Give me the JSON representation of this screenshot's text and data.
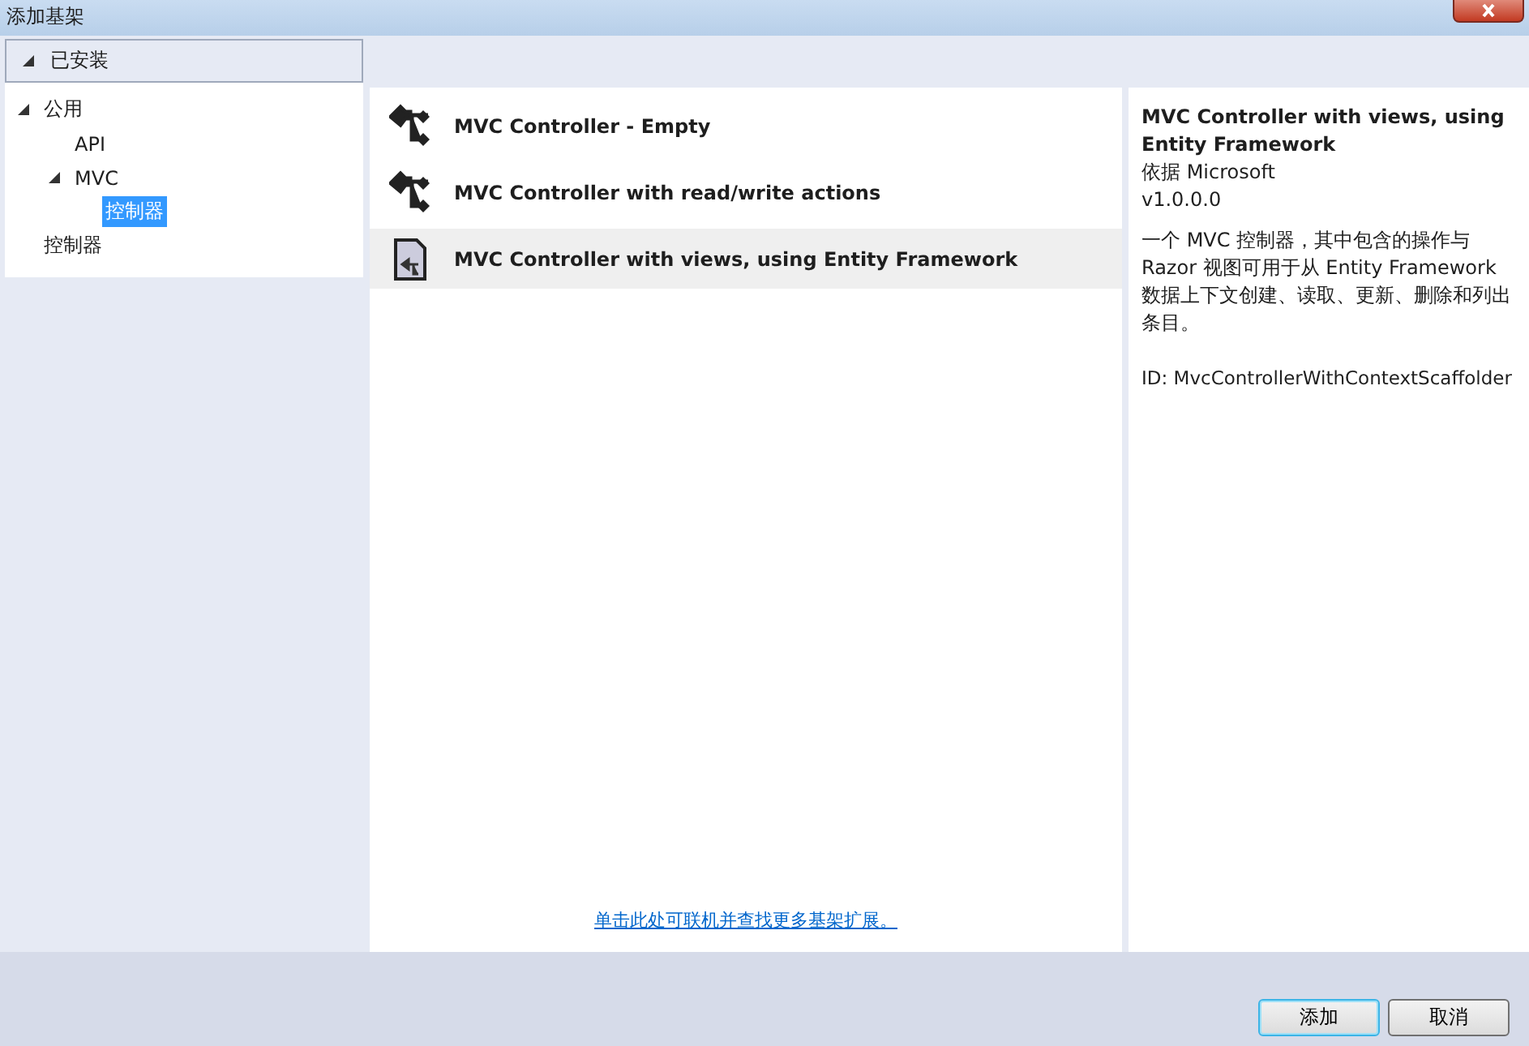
{
  "window": {
    "title": "添加基架"
  },
  "installed": {
    "label": "已安装",
    "expanded": true
  },
  "tree": [
    {
      "label": "公用",
      "expanded": true,
      "selected": false,
      "children": [
        {
          "label": "API",
          "selected": false
        },
        {
          "label": "MVC",
          "expanded": true,
          "selected": false,
          "children": [
            {
              "label": "控制器",
              "selected": true
            }
          ]
        }
      ]
    },
    {
      "label": "控制器",
      "selected": false
    }
  ],
  "templates": [
    {
      "name": "MVC Controller - Empty",
      "kind": "controller",
      "selected": false
    },
    {
      "name": "MVC Controller with read/write actions",
      "kind": "controller",
      "selected": false
    },
    {
      "name": "MVC Controller with views, using Entity Framework",
      "kind": "document",
      "selected": true
    }
  ],
  "online_link": "单击此处可联机并查找更多基架扩展。",
  "details": {
    "title": "MVC Controller with views, using Entity Framework",
    "author": "依据 Microsoft",
    "version": "v1.0.0.0",
    "description": "一个 MVC 控制器，其中包含的操作与 Razor 视图可用于从 Entity Framework 数据上下文创建、读取、更新、删除和列出条目。",
    "id": "ID: MvcControllerWithContextScaffolder"
  },
  "buttons": [
    {
      "label": "添加",
      "kind": "primary"
    },
    {
      "label": "取消",
      "kind": "normal"
    }
  ]
}
